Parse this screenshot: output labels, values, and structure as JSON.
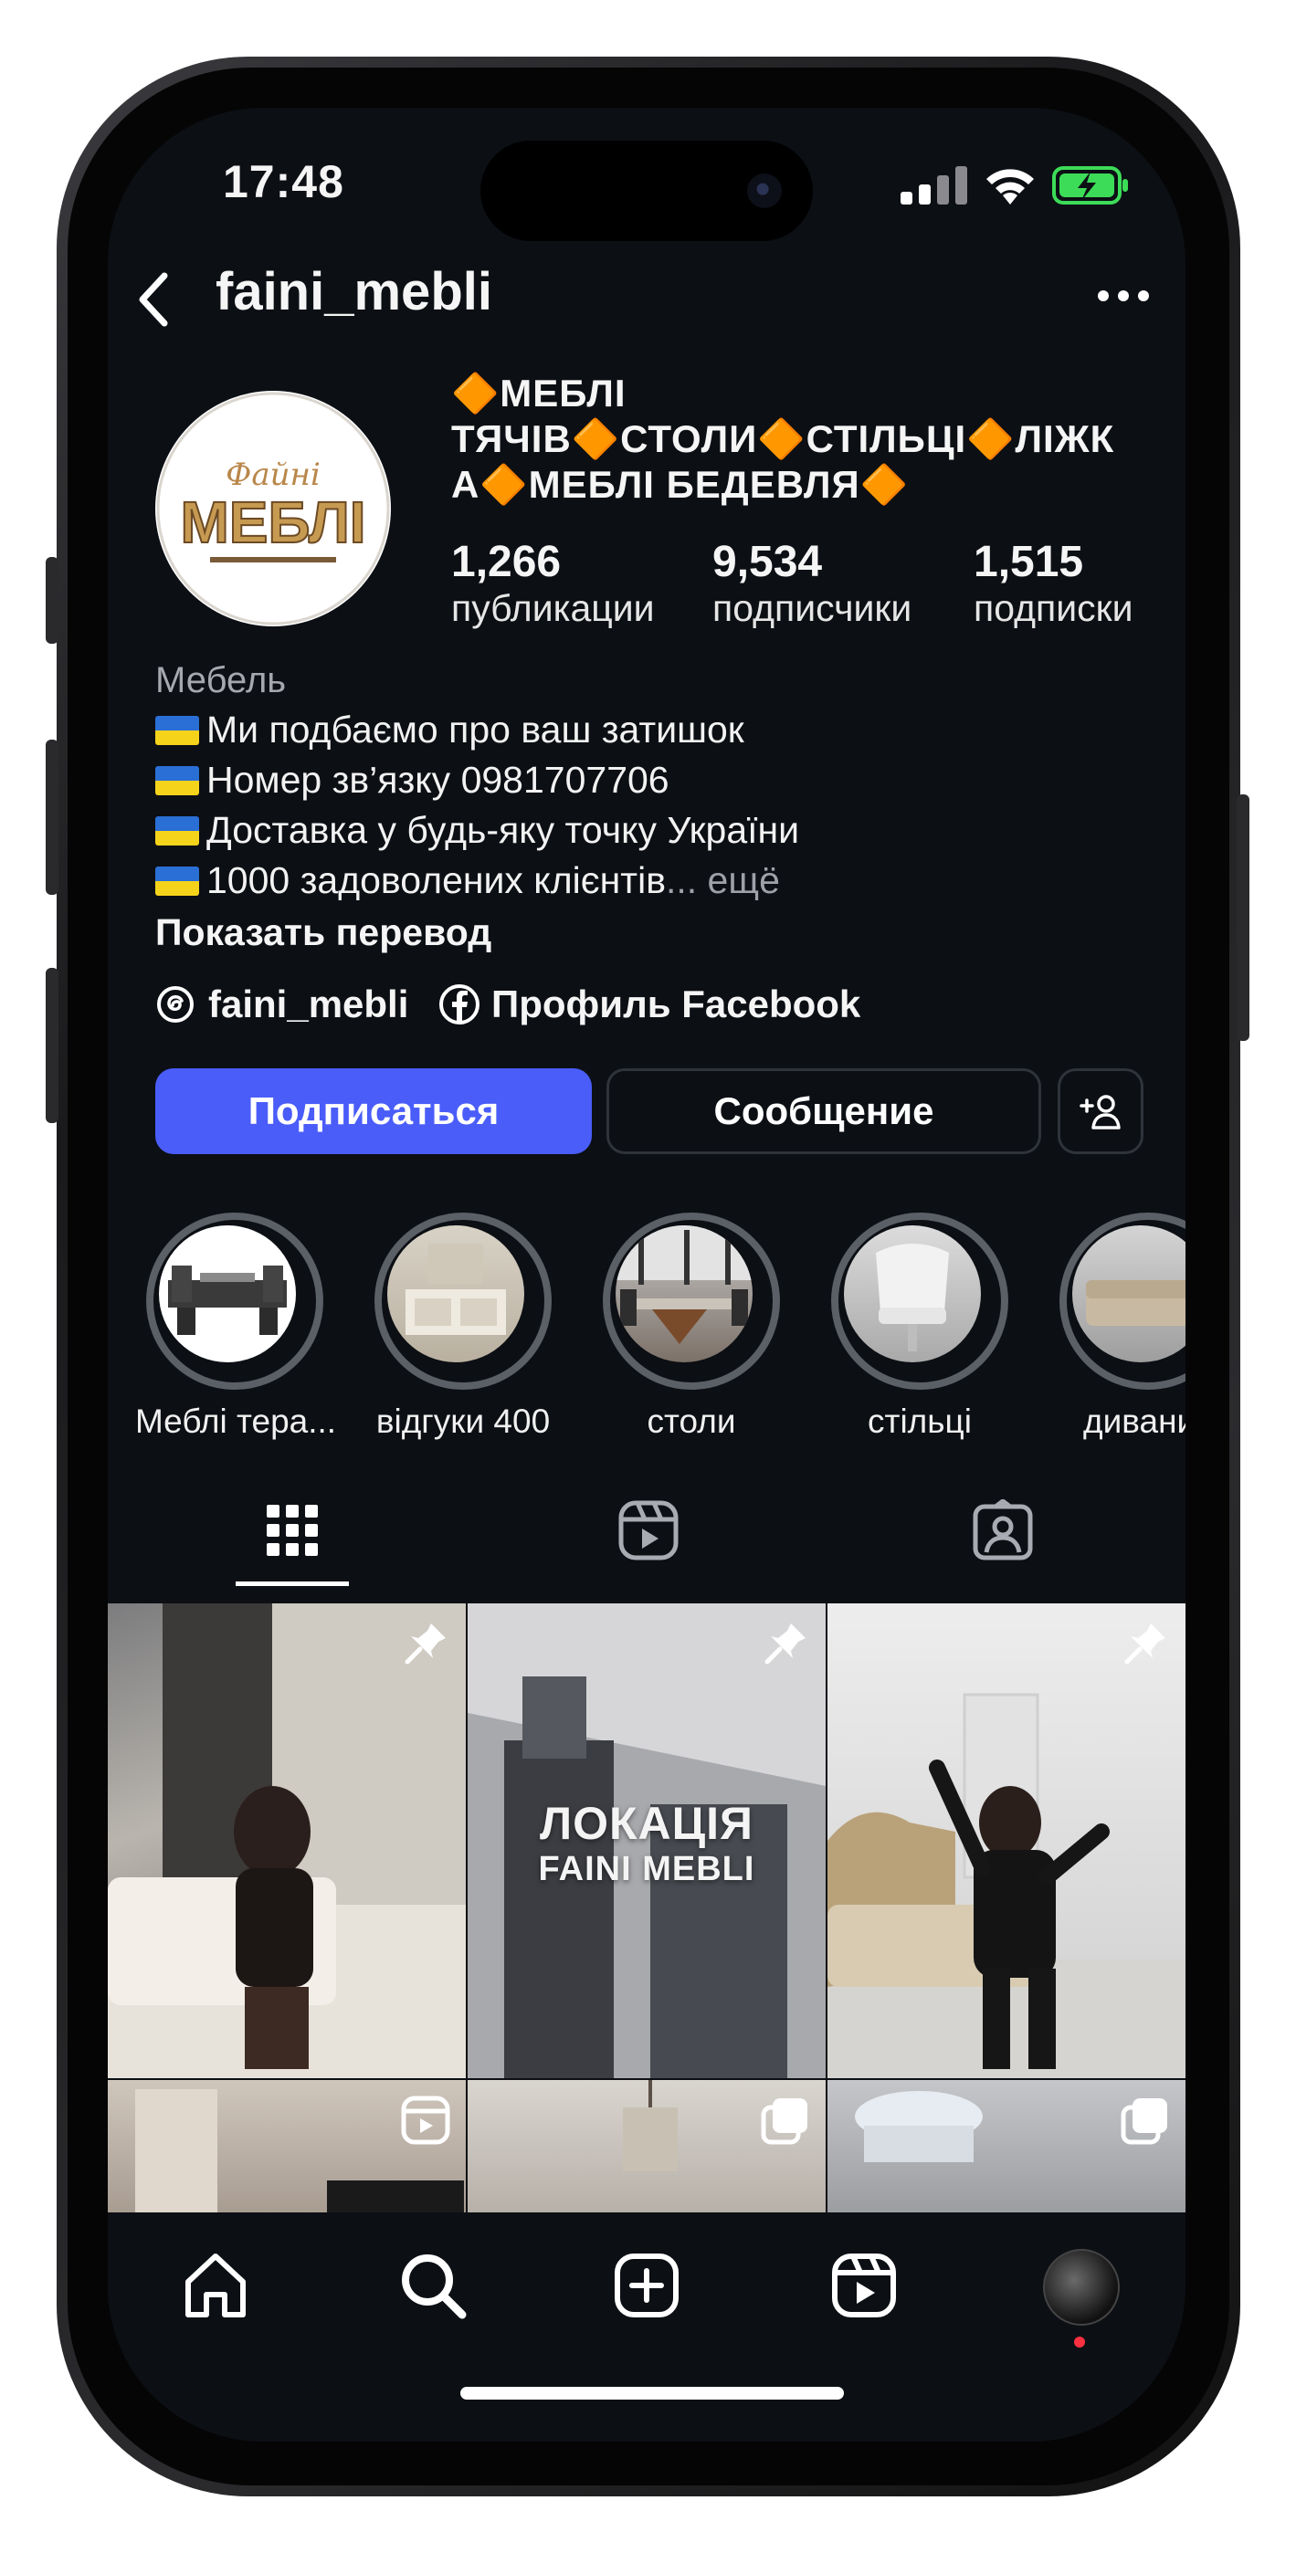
{
  "status_bar": {
    "time": "17:48"
  },
  "header": {
    "username": "faini_mebli"
  },
  "profile": {
    "display_name": "🔶МЕБЛІ ТЯЧІВ🔶СТОЛИ🔶СТІЛЬЦІ🔶ЛІЖКА🔶МЕБЛІ БЕДЕВЛЯ🔶",
    "display_name_lines": [
      "🔶МЕБЛІ",
      "ТЯЧІВ🔶СТОЛИ🔶СТІЛЬЦІ🔶ЛІЖК",
      "А🔶МЕБЛІ БЕДЕВЛЯ🔶"
    ],
    "avatar_text_script": "Файні",
    "avatar_text": "МЕБЛІ",
    "stats": [
      {
        "value": "1,266",
        "label": "публикации"
      },
      {
        "value": "9,534",
        "label": "подписчики"
      },
      {
        "value": "1,515",
        "label": "подписки"
      }
    ],
    "category": "Мебель",
    "bio_lines": [
      "Ми подбаємо про ваш затишок",
      "Номер зв’язку 0981707706",
      "Доставка у будь-яку точку України",
      "1000 задоволених клієнтів"
    ],
    "bio_more": "... ещё",
    "translate_link": "Показать перевод",
    "threads_link": "faini_mebli",
    "facebook_link": "Профиль Facebook"
  },
  "actions": {
    "follow": "Подписаться",
    "message": "Сообщение"
  },
  "highlights": [
    {
      "label": "Меблі тера..."
    },
    {
      "label": "відгуки 400"
    },
    {
      "label": "столи"
    },
    {
      "label": "стільці"
    },
    {
      "label": "дивани"
    }
  ],
  "tabs": [
    "grid-icon",
    "reels-icon",
    "tagged-icon"
  ],
  "posts": [
    {
      "type": "pinned",
      "overlay": ""
    },
    {
      "type": "pinned",
      "overlay_line1": "ЛОКАЦІЯ",
      "overlay_line2": "FAINI MEBLI"
    },
    {
      "type": "pinned",
      "overlay": ""
    },
    {
      "type": "reel",
      "overlay": ""
    },
    {
      "type": "carousel",
      "overlay": ""
    },
    {
      "type": "carousel",
      "overlay": ""
    }
  ],
  "bottom_nav": [
    "home-icon",
    "search-icon",
    "create-icon",
    "reels-icon",
    "profile-avatar"
  ],
  "colors": {
    "background": "#0c0f14",
    "accent": "#4a5df9",
    "text": "#f5f5f5",
    "secondary": "#a5a8ae"
  }
}
